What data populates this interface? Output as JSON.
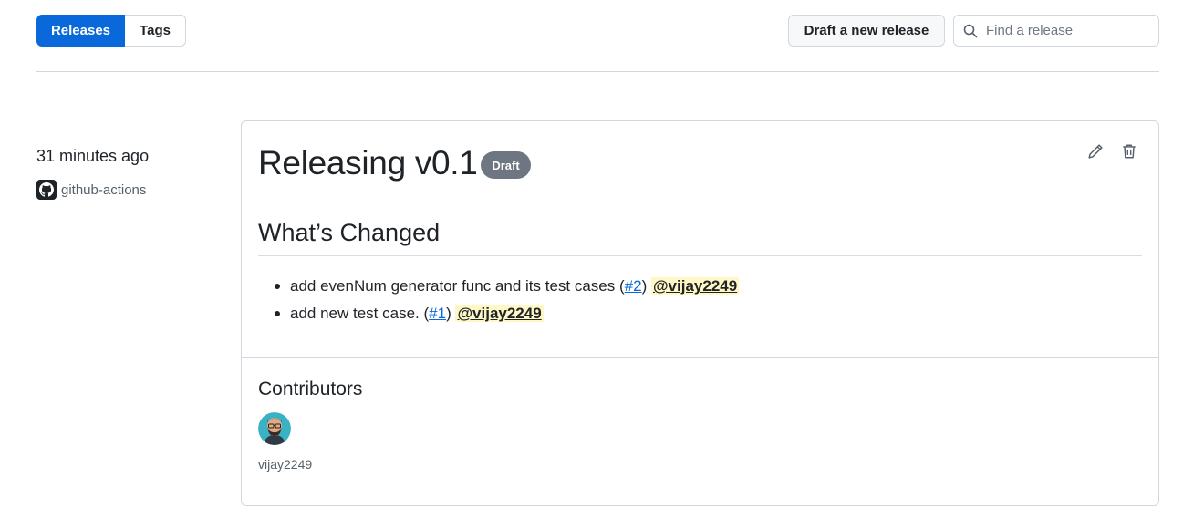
{
  "tabs": [
    {
      "label": "Releases",
      "active": true
    },
    {
      "label": "Tags",
      "active": false
    }
  ],
  "toolbar": {
    "draft_label": "Draft a new release",
    "search_placeholder": "Find a release"
  },
  "release": {
    "time_ago": "31 minutes ago",
    "author": "github-actions",
    "title": "Releasing v0.1",
    "badge": "Draft",
    "section_title": "What’s Changed",
    "changes": [
      {
        "text": "add evenNum generator func and its test cases (",
        "pr": "#2",
        "close": ")",
        "mention": "@vijay2249"
      },
      {
        "text": "add new test case. (",
        "pr": "#1",
        "close": ")",
        "mention": "@vijay2249"
      }
    ],
    "contributors_title": "Contributors",
    "contributors": [
      {
        "name": "vijay2249"
      }
    ]
  },
  "colors": {
    "accent": "#0969da",
    "badge": "#6e7781",
    "mention_bg": "#fff8c5"
  },
  "icons": [
    "search-icon",
    "github-logo-icon",
    "pencil-icon",
    "trash-icon"
  ]
}
